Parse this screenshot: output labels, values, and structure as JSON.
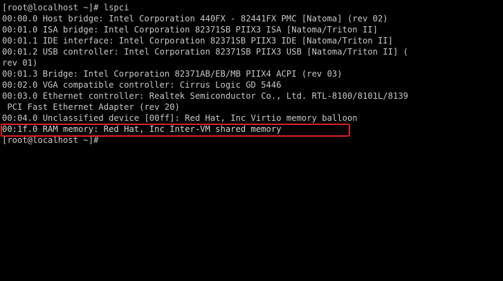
{
  "terminal": {
    "lines": [
      "[root@localhost ~]# lspci",
      "00:00.0 Host bridge: Intel Corporation 440FX - 82441FX PMC [Natoma] (rev 02)",
      "00:01.0 ISA bridge: Intel Corporation 82371SB PIIX3 ISA [Natoma/Triton II]",
      "00:01.1 IDE interface: Intel Corporation 82371SB PIIX3 IDE [Natoma/Triton II]",
      "00:01.2 USB controller: Intel Corporation 82371SB PIIX3 USB [Natoma/Triton II] (",
      "rev 01)",
      "00:01.3 Bridge: Intel Corporation 82371AB/EB/MB PIIX4 ACPI (rev 03)",
      "00:02.0 VGA compatible controller: Cirrus Logic GD 5446",
      "00:03.0 Ethernet controller: Realtek Semiconductor Co., Ltd. RTL-8100/8101L/8139",
      " PCI Fast Ethernet Adapter (rev 20)",
      "00:04.0 Unclassified device [00ff]: Red Hat, Inc Virtio memory balloon",
      "00:1f.0 RAM memory: Red Hat, Inc Inter-VM shared memory",
      "[root@localhost ~]# "
    ],
    "highlight_color": "#e02020",
    "background_color": "#000000",
    "text_color": "#c8c8c8"
  }
}
